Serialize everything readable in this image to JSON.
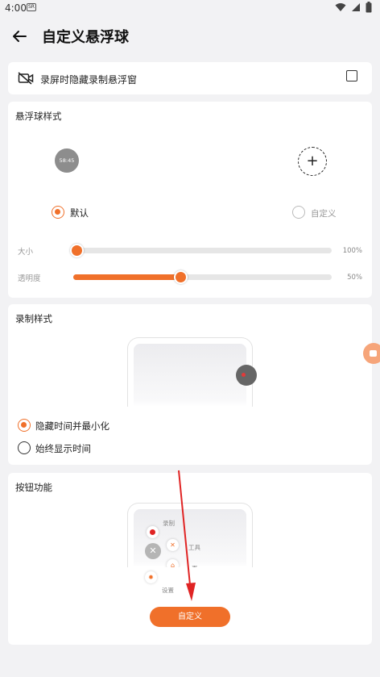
{
  "status_bar": {
    "time": "4:00",
    "record_badge": "SR"
  },
  "app_bar": {
    "title": "自定义悬浮球"
  },
  "hide_on_record": {
    "label": "录屏时隐藏录制悬浮窗",
    "checked": false
  },
  "ball_style": {
    "title": "悬浮球样式",
    "preview_time": "58:45",
    "options": [
      {
        "label": "默认",
        "selected": true
      },
      {
        "label": "自定义",
        "selected": false
      }
    ],
    "size": {
      "label": "大小",
      "value_text": "100%",
      "level": 0.0
    },
    "opacity": {
      "label": "透明度",
      "value_text": "50%",
      "level": 0.41
    }
  },
  "record_style": {
    "title": "录制样式",
    "options": [
      {
        "label": "隐藏时间并最小化",
        "selected": true
      },
      {
        "label": "始终显示时间",
        "selected": false
      }
    ]
  },
  "button_function": {
    "title": "按钮功能",
    "menu": {
      "record": "录制",
      "tools": "工具",
      "home": "页",
      "settings": "设置"
    },
    "customize_button": "自定义"
  },
  "colors": {
    "accent": "#f0702a",
    "background": "#f2f2f4",
    "card": "#ffffff",
    "arrow": "#e02424"
  },
  "icons": [
    "back-arrow-icon",
    "camera-off-icon",
    "plus-icon",
    "wifi-icon",
    "signal-icon",
    "battery-icon"
  ]
}
